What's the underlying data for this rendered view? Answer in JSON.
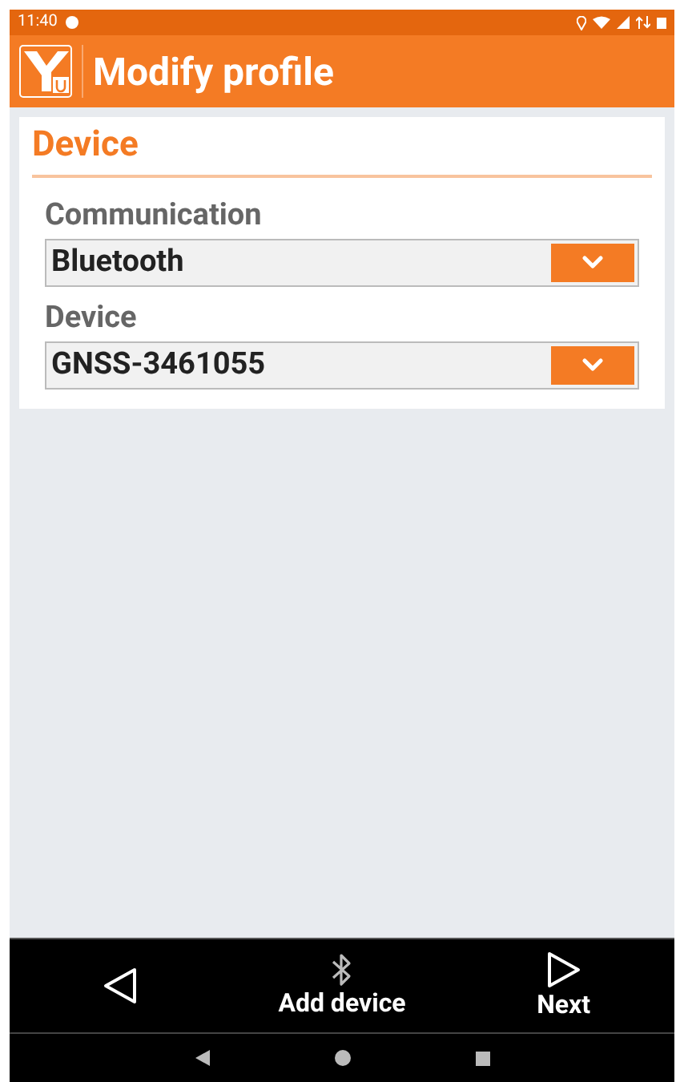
{
  "status_bar": {
    "time": "11:40"
  },
  "app_bar": {
    "title": "Modify profile"
  },
  "section": {
    "title": "Device",
    "fields": [
      {
        "label": "Communication",
        "value": "Bluetooth"
      },
      {
        "label": "Device",
        "value": "GNSS-3461055"
      }
    ]
  },
  "bottom_bar": {
    "buttons": [
      {
        "kind": "back"
      },
      {
        "kind": "bluetooth",
        "label": "Add device"
      },
      {
        "kind": "next",
        "label": "Next"
      }
    ]
  }
}
